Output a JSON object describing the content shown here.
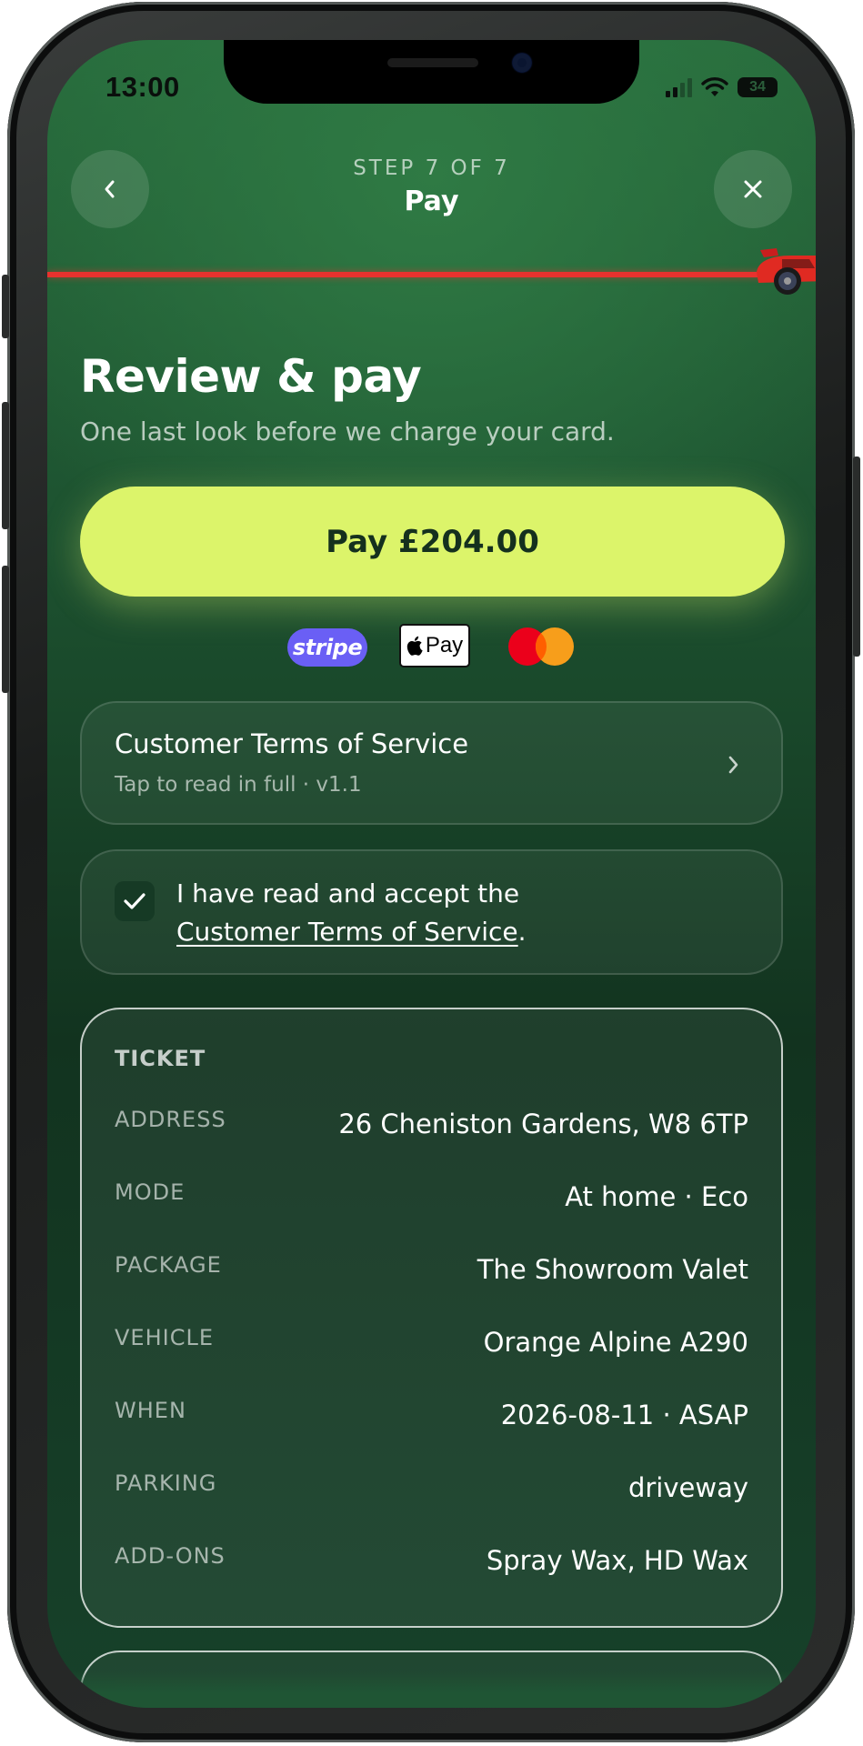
{
  "status_bar": {
    "time": "13:00",
    "battery": "34"
  },
  "header": {
    "step_label": "STEP 7 OF 7",
    "title": "Pay",
    "progress": 1.0,
    "back_icon": "chevron-left-icon",
    "close_icon": "close-icon"
  },
  "page": {
    "title": "Review & pay",
    "subtitle": "One last look before we charge your card."
  },
  "pay_button": {
    "label": "Pay £204.00"
  },
  "payment_methods": {
    "stripe": "stripe",
    "apple_pay": "Pay",
    "mastercard": "mastercard-logo"
  },
  "terms_card": {
    "title": "Customer Terms of Service",
    "subtitle": "Tap to read in full · v1.1"
  },
  "accept": {
    "checked": true,
    "line1": "I have read and accept the",
    "link": "Customer Terms of Service",
    "suffix": "."
  },
  "ticket": {
    "heading": "TICKET",
    "rows": [
      {
        "label": "ADDRESS",
        "value": "26 Cheniston Gardens, W8 6TP"
      },
      {
        "label": "MODE",
        "value": "At home · Eco"
      },
      {
        "label": "PACKAGE",
        "value": "The Showroom Valet"
      },
      {
        "label": "VEHICLE",
        "value": "Orange Alpine A290"
      },
      {
        "label": "WHEN",
        "value": "2026-08-11 · ASAP"
      },
      {
        "label": "PARKING",
        "value": "driveway"
      },
      {
        "label": "ADD-ONS",
        "value": "Spray Wax, HD Wax"
      }
    ]
  },
  "colors": {
    "accent": "#dcf46a",
    "progress": "#e8322e",
    "background_top": "#276b3c",
    "background_bottom": "#12331f"
  }
}
